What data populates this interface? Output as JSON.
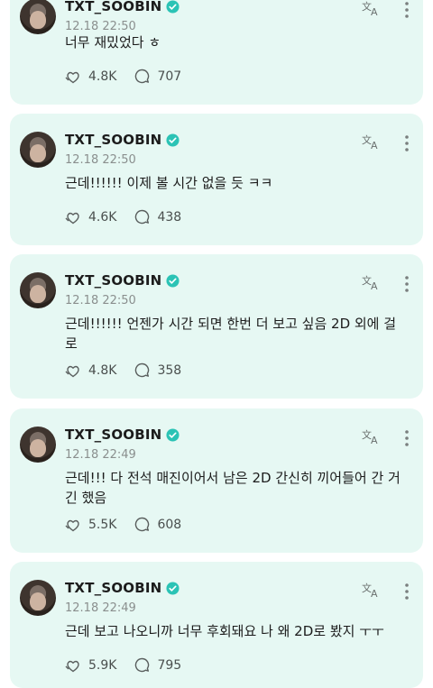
{
  "posts": [
    {
      "author": "TXT_SOOBIN",
      "time": "12.18 22:50",
      "text": "너무 재밌었다 ㅎ",
      "likes": "4.8K",
      "comments": "707"
    },
    {
      "author": "TXT_SOOBIN",
      "time": "12.18 22:50",
      "text": "근데!!!!!! 이제 볼 시간 없을 듯 ㅋㅋ",
      "likes": "4.6K",
      "comments": "438"
    },
    {
      "author": "TXT_SOOBIN",
      "time": "12.18 22:50",
      "text": "근데!!!!!! 언젠가 시간 되면 한번 더 보고 싶음 2D 외에 걸로",
      "likes": "4.8K",
      "comments": "358"
    },
    {
      "author": "TXT_SOOBIN",
      "time": "12.18 22:49",
      "text": "근데!!! 다 전석 매진이어서 남은 2D 간신히 끼어들어 간 거긴 했음",
      "likes": "5.5K",
      "comments": "608"
    },
    {
      "author": "TXT_SOOBIN",
      "time": "12.18 22:49",
      "text": "근데 보고 나오니까 너무 후회돼요 나 왜 2D로 봤지 ㅜㅜ",
      "likes": "5.9K",
      "comments": "795"
    }
  ],
  "colors": {
    "card": "#e6f8f3",
    "verified": "#2bc3b5"
  }
}
